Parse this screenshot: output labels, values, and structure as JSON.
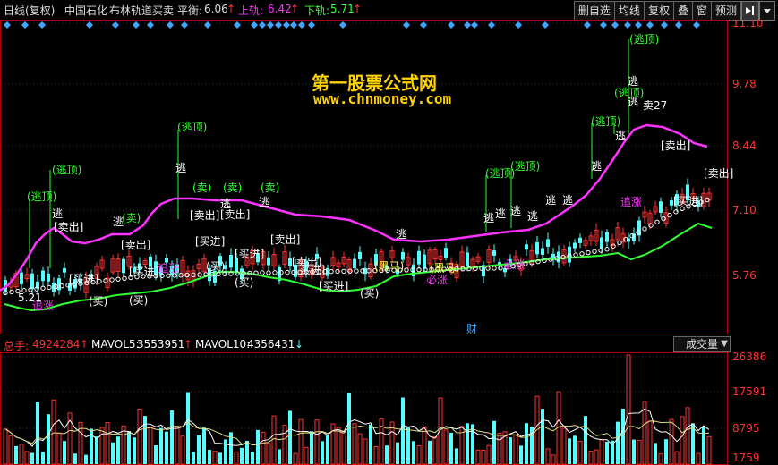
{
  "header": {
    "period": "日线(复权)",
    "stock_name": "中国石化",
    "indicator_name": "布林轨道买卖",
    "balance_label": "平衡:",
    "balance_value": "6.06",
    "upper_label": "上轨:",
    "upper_value": "6.42",
    "lower_label": "下轨:",
    "lower_value": "5.71",
    "toolbar": [
      "删自选",
      "均线",
      "复权",
      "叠",
      "窗",
      "预测"
    ]
  },
  "watermark": {
    "title": "第一股票公式网",
    "url": "www.chnmoney.com"
  },
  "main_chart": {
    "y_ticks": [
      "11.10",
      "9.78",
      "8.44",
      "7.10",
      "5.76"
    ],
    "low_label": "5.21",
    "peak_label": "卖27",
    "finance_marker": "财",
    "annotations": {
      "escape_top": "(逃顶)",
      "escape": "逃",
      "sell_circle": "(卖)",
      "buy_circle": "(买)",
      "sell_bracket": "[卖出]",
      "buy_bracket": "[买进]",
      "dark_horse": "(黑马)",
      "chase_rise": "追涨",
      "must_rise": "必涨"
    }
  },
  "volume": {
    "total_label": "总手:",
    "total_value": "4924284",
    "mavol5_label": "MAVOL5:",
    "mavol5_value": "3553951",
    "mavol10_label": "MAVOL10:",
    "mavol10_value": "4356431",
    "selector": "成交量",
    "y_ticks": [
      "26386",
      "17591",
      "8795",
      "1759"
    ]
  },
  "colors": {
    "rising": "#ff3232",
    "falling": "#54ffff",
    "upper_band": "#ff32ff",
    "lower_band": "#32ff32",
    "mid_band": "#ffffff",
    "signal_text": "#ffff54",
    "label_text": "#ffffff",
    "axis": "#b00000",
    "diamond": "#3fa5ff"
  }
}
